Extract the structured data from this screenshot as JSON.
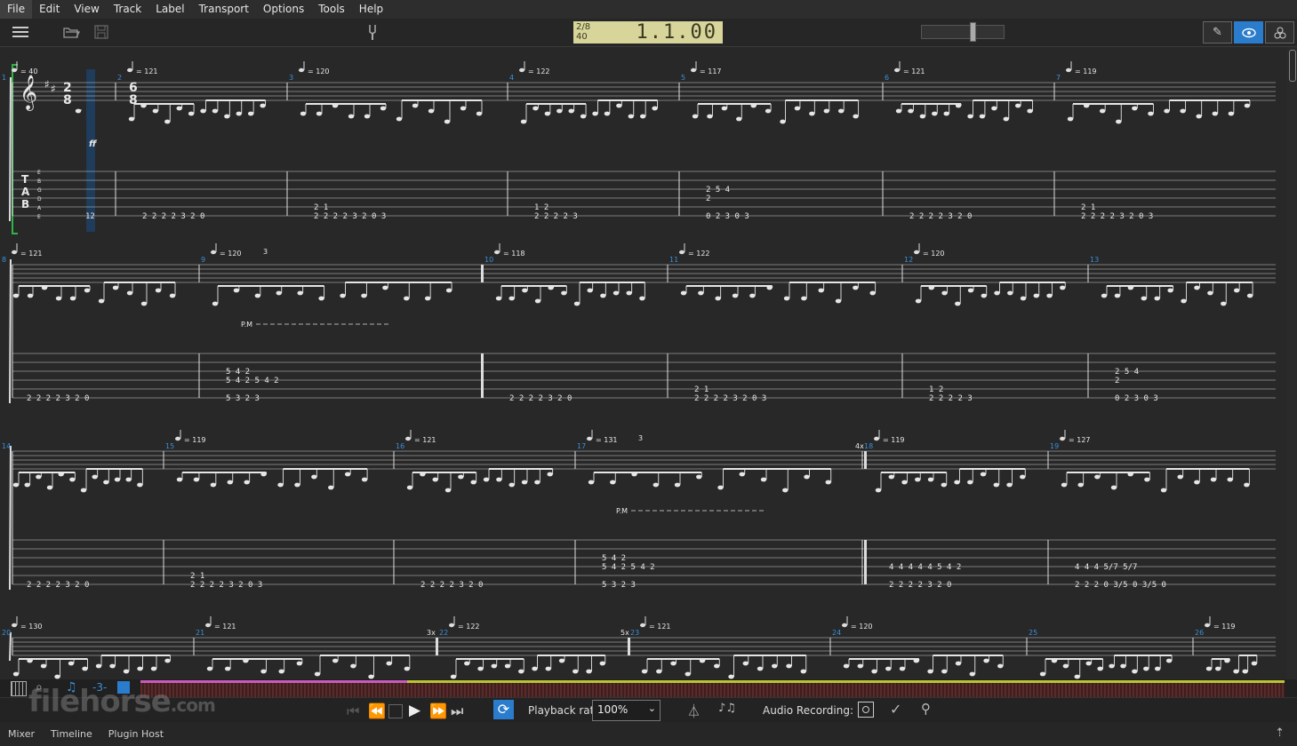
{
  "menu": [
    "File",
    "Edit",
    "View",
    "Track",
    "Label",
    "Transport",
    "Options",
    "Tools",
    "Help"
  ],
  "lcd": {
    "signature": "2/8",
    "tempo": "40",
    "position": "1.1.00"
  },
  "systems": [
    {
      "measures": [
        {
          "num": "1",
          "tempo": "= 40",
          "tab": [
            "",
            "",
            "",
            "",
            "",
            "12"
          ]
        },
        {
          "num": "2",
          "tempo": "= 121",
          "tab": [
            "",
            "",
            "",
            "",
            "",
            "2  2  2  2  3  2  0"
          ]
        },
        {
          "num": "3",
          "tempo": "= 120",
          "tab": [
            "",
            "",
            "",
            "",
            "2  1",
            "2  2  2  2  3  2  0        3"
          ]
        },
        {
          "num": "4",
          "tempo": "= 122",
          "tab": [
            "",
            "",
            "",
            "",
            "1  2",
            "2  2  2  2  3"
          ]
        },
        {
          "num": "5",
          "tempo": "= 117",
          "tab": [
            "",
            "",
            "2  5  4",
            "2",
            "",
            "0  2  3        0  3"
          ]
        },
        {
          "num": "6",
          "tempo": "= 121",
          "tab": [
            "",
            "",
            "",
            "",
            "",
            "2  2  2  2  3  2  0"
          ]
        },
        {
          "num": "7",
          "tempo": "= 119",
          "tab": [
            "",
            "",
            "",
            "",
            "2  1",
            "2  2  2  2  3  2  0        3"
          ]
        }
      ]
    },
    {
      "measures": [
        {
          "num": "8",
          "tempo": "= 121",
          "tab": [
            "",
            "",
            "",
            "",
            "",
            "2  2  2  2  3  2  0"
          ]
        },
        {
          "num": "9",
          "tempo": "= 120",
          "tab": [
            "",
            "",
            "5  4  2",
            "5  4  2     5  4  2",
            "",
            "5  3  2        3"
          ]
        },
        {
          "num": "10",
          "tempo": "= 118",
          "tab": [
            "",
            "",
            "",
            "",
            "",
            "2  2  2  2  3  2  0"
          ]
        },
        {
          "num": "11",
          "tempo": "= 122",
          "tab": [
            "",
            "",
            "",
            "",
            "2  1",
            "2  2  2  2  3  2  0        3"
          ]
        },
        {
          "num": "12",
          "tempo": "= 120",
          "tab": [
            "",
            "",
            "",
            "",
            "1  2",
            "2  2  2  2  3"
          ]
        },
        {
          "num": "13",
          "tempo": "",
          "tab": [
            "",
            "",
            "2  5  4",
            "2",
            "",
            "0  2  3        0  3"
          ]
        }
      ]
    },
    {
      "measures": [
        {
          "num": "14",
          "tempo": "",
          "tab": [
            "",
            "",
            "",
            "",
            "",
            "2  2  2  2  3  2  0"
          ]
        },
        {
          "num": "15",
          "tempo": "= 119",
          "tab": [
            "",
            "",
            "",
            "",
            "2  1",
            "2  2  2  2  3  2  0        3"
          ]
        },
        {
          "num": "16",
          "tempo": "= 121",
          "tab": [
            "",
            "",
            "",
            "",
            "",
            "2  2  2  2  3  2  0"
          ]
        },
        {
          "num": "17",
          "tempo": "= 131",
          "tab": [
            "",
            "",
            "5  4  2",
            "5  4  2     5  4  2",
            "",
            "5  3  2        3"
          ]
        },
        {
          "num": "18",
          "tempo": "= 119",
          "tab": [
            "",
            "",
            "",
            "4  4  4  4  4  5  4  2",
            "",
            "2  2  2  2  3  2  0"
          ]
        },
        {
          "num": "19",
          "tempo": "= 127",
          "tab": [
            "",
            "",
            "",
            "4  4  4     5/7     5/7",
            "",
            "2  2  2  0  3/5  0  3/5  0"
          ]
        }
      ]
    },
    {
      "measures": [
        {
          "num": "20",
          "tempo": "= 130"
        },
        {
          "num": "21",
          "tempo": "= 121"
        },
        {
          "num": "22",
          "tempo": "= 122"
        },
        {
          "num": "23",
          "tempo": "= 121"
        },
        {
          "num": "24",
          "tempo": "= 120"
        },
        {
          "num": "25",
          "tempo": ""
        },
        {
          "num": "26",
          "tempo": "= 119"
        }
      ]
    }
  ],
  "system_labels": {
    "time_sig_1": [
      "2",
      "8"
    ],
    "time_sig_2": [
      "6",
      "8"
    ],
    "tab_letters": [
      "T",
      "A",
      "B"
    ],
    "string_names": [
      "E",
      "B",
      "G",
      "D",
      "A",
      "E"
    ],
    "dynamics": "ff",
    "palm_mute": "P.M",
    "triplet": "3",
    "repeat_4x": "4x",
    "repeat_3x": "3x",
    "repeat_5x": "5x"
  },
  "transport": {
    "playback_rate_label": "Playback rate:",
    "playback_rate_value": "100%",
    "audio_recording_label": "Audio Recording:"
  },
  "status": [
    "Mixer",
    "Timeline",
    "Plugin Host"
  ],
  "watermark": {
    "text": "filehorse",
    "suffix": ".com"
  },
  "colors": {
    "accent": "#2a7ccc",
    "lcd": "#d8d59a",
    "measure_num": "#3a8fd8",
    "selection": "#1f3c5a"
  }
}
